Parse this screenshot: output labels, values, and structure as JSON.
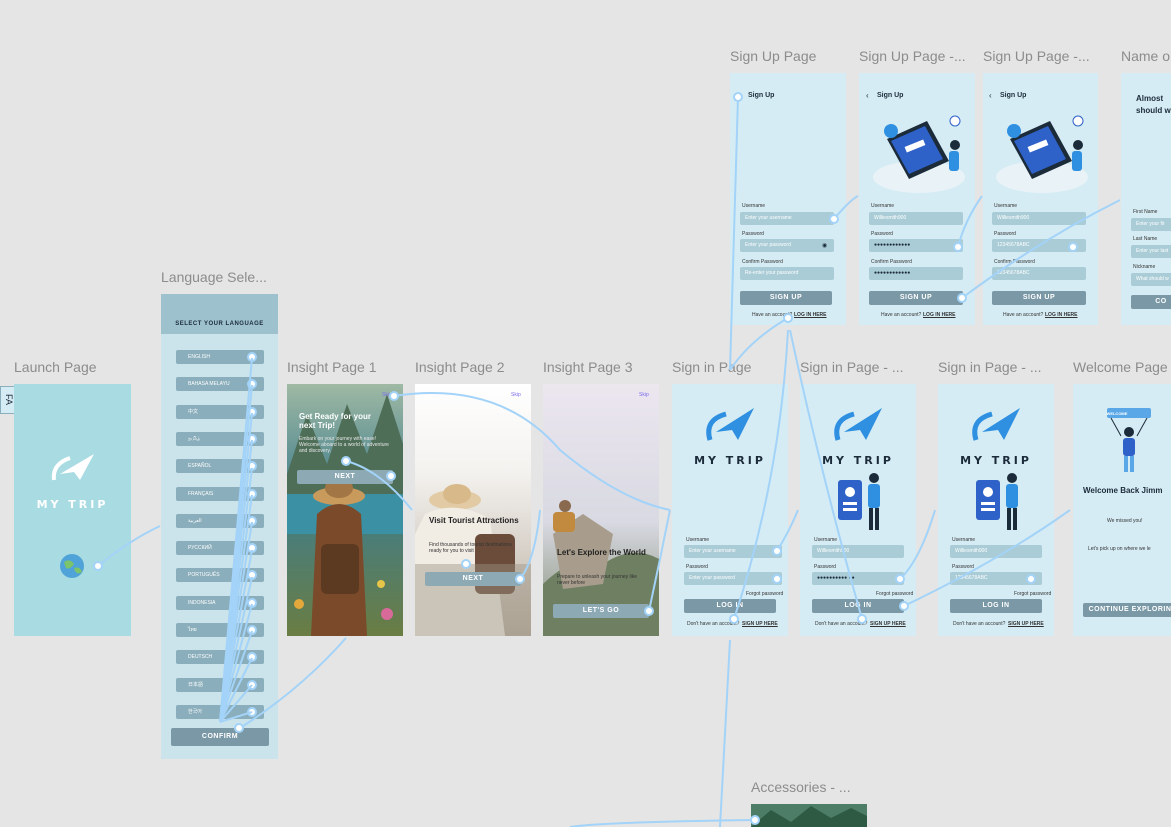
{
  "frames": {
    "launch": {
      "label": "Launch Page",
      "brand": "MY TRIP"
    },
    "language": {
      "label": "Language Sele...",
      "header": "SELECT YOUR LANGUAGE",
      "languages": [
        "ENGLISH",
        "BAHASA MELAYU",
        "中文",
        "தமிழ்",
        "ESPAÑOL",
        "FRANÇAIS",
        "العربية",
        "РУССКИЙ",
        "PORTUGUÊS",
        "INDONESIA",
        "ไทย",
        "DEUTSCH",
        "日本語",
        "한국어"
      ],
      "confirm": "CONFIRM"
    },
    "insight1": {
      "label": "Insight Page 1",
      "title": "Get Ready for your next Trip!",
      "body": "Embark on your journey with ease! Welcome aboard to a world of adventure and discovery.",
      "button": "NEXT",
      "skip": "Skip"
    },
    "insight2": {
      "label": "Insight Page 2",
      "title": "Visit Tourist Attractions",
      "body": "Find thousands of tourist destinations ready for you to visit",
      "button": "NEXT",
      "skip": "Skip"
    },
    "insight3": {
      "label": "Insight Page 3",
      "title": "Let's Explore the World",
      "body": "Prepare to unleash your journey like never before",
      "button": "LET'S GO",
      "skip": "Skip"
    },
    "signin1": {
      "label": "Sign in Page",
      "brand": "MY TRIP",
      "username_label": "Username",
      "username_placeholder": "Enter your username",
      "password_label": "Password",
      "password_placeholder": "Enter your password",
      "forgot": "Forgot password",
      "login": "LOG IN",
      "no_account": "Don't have an account?",
      "signup_link": "SIGN UP HERE"
    },
    "signin2": {
      "label": "Sign in Page - ...",
      "brand": "MY TRIP",
      "username_label": "Username",
      "username_value": "Williesmith900",
      "password_label": "Password",
      "password_value": "●●●●●●●●●● ●●",
      "forgot": "Forgot password",
      "login": "LOG IN",
      "no_account": "Don't have an account?",
      "signup_link": "SIGN UP HERE"
    },
    "signin3": {
      "label": "Sign in Page - ...",
      "brand": "MY TRIP",
      "username_label": "Username",
      "username_value": "Williesmith900",
      "password_label": "Password",
      "password_value": "12345678ABC",
      "forgot": "Forgot password",
      "login": "LOG IN",
      "no_account": "Don't have an account?",
      "signup_link": "SIGN UP HERE"
    },
    "welcome": {
      "label": "Welcome Page",
      "title": "Welcome Back Jimm",
      "sub": "We missed you!",
      "body": "Let's pick up on where we le",
      "button": "CONTINUE EXPLORING",
      "sign": "WELCOME"
    },
    "signup1": {
      "label": "Sign Up Page",
      "title": "Sign Up",
      "username_label": "Username",
      "username_placeholder": "Enter your username",
      "password_label": "Password",
      "password_placeholder": "Enter your password",
      "confirm_label": "Confirm Password",
      "confirm_placeholder": "Re-enter your password",
      "button": "SIGN UP",
      "have_account": "Have an account?",
      "login_link": "LOG IN HERE"
    },
    "signup2": {
      "label": "Sign Up Page -...",
      "title": "Sign Up",
      "username_label": "Username",
      "username_value": "Williesmith900",
      "password_label": "Password",
      "password_value": "●●●●●●●●●●●●",
      "confirm_label": "Confirm Password",
      "confirm_value": "●●●●●●●●●●●●",
      "button": "SIGN UP",
      "have_account": "Have an account?",
      "login_link": "LOG IN HERE"
    },
    "signup3": {
      "label": "Sign Up Page -...",
      "title": "Sign Up",
      "username_label": "Username",
      "username_value": "Williesmith900",
      "password_label": "Password",
      "password_value": "12345678ABC",
      "confirm_label": "Confirm Password",
      "confirm_value": "12345678ABC",
      "button": "SIGN UP",
      "have_account": "Have an account?",
      "login_link": "LOG IN HERE"
    },
    "name": {
      "label": "Name o",
      "title": "Almost should w",
      "first_label": "First Name",
      "first_placeholder": "Enter your fir",
      "last_label": "Last Name",
      "last_placeholder": "Enter your last",
      "nick_label": "Nickname",
      "nick_placeholder": "What should w",
      "button": "CO"
    },
    "accessories": {
      "label": "Accessories - ..."
    }
  },
  "edge_tab": "FA",
  "colors": {
    "canvas": "#e5e5e5",
    "frame_bg": "#d5ecf4",
    "wire": "#a3d3f8",
    "button": "#7b98a6",
    "field": "#a9ccd6",
    "brand_blue": "#2f8fe0"
  }
}
